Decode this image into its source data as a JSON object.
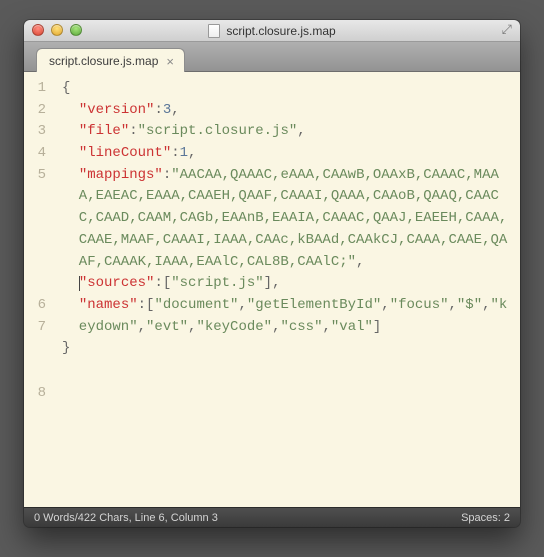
{
  "window": {
    "title": "script.closure.js.map"
  },
  "tabs": [
    {
      "label": "script.closure.js.map",
      "close": "×"
    }
  ],
  "editor": {
    "gutter": [
      "1",
      "2",
      "3",
      "4",
      "5",
      "6",
      "7",
      "8"
    ],
    "line1": {
      "open": "{"
    },
    "line2": {
      "key": "\"version\"",
      "colon": ":",
      "val": "3",
      "comma": ","
    },
    "line3": {
      "key": "\"file\"",
      "colon": ":",
      "val": "\"script.closure.js\"",
      "comma": ","
    },
    "line4": {
      "key": "\"lineCount\"",
      "colon": ":",
      "val": "1",
      "comma": ","
    },
    "line5": {
      "key": "\"mappings\"",
      "colon": ":",
      "val": "\"AACAA,QAAAC,eAAA,CAAwB,OAAxB,CAAAC,MAAA,EAEAC,EAAA,CAAEH,QAAF,CAAAI,QAAA,CAAoB,QAAQ,CAACC,CAAD,CAAM,CAGb,EAAnB,EAAIA,CAAAC,QAAJ,EAEEH,CAAA,CAAE,MAAF,CAAAI,IAAA,CAAc,kBAAd,CAAkCJ,CAAA,CAAE,QAAF,CAAAK,IAAA,EAAlC,CAL8B,CAAlC;\"",
      "comma": ","
    },
    "line6": {
      "key": "\"sources\"",
      "colon": ":",
      "lb": "[",
      "val": "\"script.js\"",
      "rb": "]",
      "comma": ","
    },
    "line7": {
      "key": "\"names\"",
      "colon": ":",
      "lb": "[",
      "vals": [
        "\"document\"",
        "\"getElementById\"",
        "\"focus\"",
        "\"$\"",
        "\"keydown\"",
        "\"evt\"",
        "\"keyCode\"",
        "\"css\"",
        "\"val\""
      ],
      "rb": "]"
    },
    "line8": {
      "close": "}"
    }
  },
  "status": {
    "left": "0 Words/422 Chars, Line 6, Column 3",
    "right": "Spaces: 2"
  }
}
